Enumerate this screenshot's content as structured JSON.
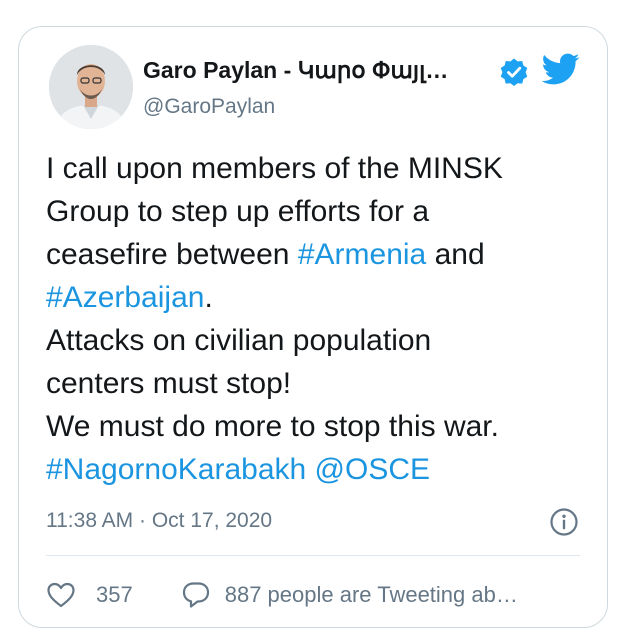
{
  "tweet": {
    "author_name": "Garo Paylan - Կարօ Փայլ…",
    "handle": "@GaroPaylan",
    "text_lines": [
      [
        {
          "t": "I call upon members of the MINSK",
          "link": false
        }
      ],
      [
        {
          "t": "Group to step up efforts for a",
          "link": false
        }
      ],
      [
        {
          "t": "ceasefire between ",
          "link": false
        },
        {
          "t": "#Armenia",
          "link": true
        },
        {
          "t": " and",
          "link": false
        }
      ],
      [
        {
          "t": "#Azerbaijan",
          "link": true
        },
        {
          "t": ".",
          "link": false
        }
      ],
      [
        {
          "t": "Attacks on civilian population",
          "link": false
        }
      ],
      [
        {
          "t": "centers must stop!",
          "link": false
        }
      ],
      [
        {
          "t": "We must do more to stop this war.",
          "link": false
        }
      ],
      [
        {
          "t": "#NagornoKarabakh",
          "link": true
        },
        {
          "t": " ",
          "link": false
        },
        {
          "t": "@OSCE",
          "link": true
        }
      ]
    ],
    "timestamp": "11:38 AM · Oct 17, 2020",
    "like_count": "357",
    "conversation_text": "887 people are Tweeting ab…"
  },
  "icons": {
    "avatar": "avatar-photo",
    "verified": "verified-badge-icon",
    "brand": "twitter-bird-icon",
    "info": "info-icon",
    "like": "heart-icon",
    "conversation": "speech-bubble-icon"
  },
  "colors": {
    "link": "#1b95e0",
    "brand": "#1da1f2",
    "secondary_text": "#657786",
    "border": "#cfd9de"
  }
}
